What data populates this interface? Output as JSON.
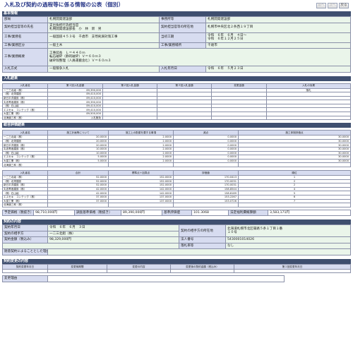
{
  "page": {
    "title": "入札及び契約の過程等に係る情報の公表（個別）"
  },
  "nav": {
    "prev": "前へ",
    "next": "次へ",
    "back": "戻る"
  },
  "basic": {
    "heading": "基本情報",
    "dept_label": "部局",
    "dept": "札幌開発建設部",
    "office_label": "事務所等",
    "office": "札幌開発建設部",
    "contractor_label": "契約担当官等の氏名",
    "contractor_1": "支出負担行為担当官",
    "contractor_2": "札幌開発建設部長　小　林　新　男",
    "contractor_addr_label": "契約担当官等の所在地",
    "contractor_addr": "札幌市中央区北２条西１９丁目",
    "work_name_label": "工事/業務名",
    "work_name": "一般国道４５３号　千歳市　支笏剣淵対策工事",
    "period_label": "当初工期",
    "period_1": "令和　６年　６月　４日～",
    "period_2": "令和　６年１２月２５日",
    "category_label": "工事/業務区分",
    "category": "一般土木",
    "place_label": "工事/業務場所",
    "place": "千歳市",
    "summary_label": "工事/業務概要",
    "summary_1": "工事延長　Ｌ＝４４０ｍ",
    "summary_2": "転石破砕（静的破砕）Ｖ＝６０ｍ３",
    "summary_3": "破砕殻整理（人員運搬含む）Ｖ＝６０ｍ３",
    "method_label": "入札方式",
    "method": "一般競争入札",
    "bid_date_label": "入札年月日",
    "bid_date": "令和　６年　５月２３日"
  },
  "results": {
    "heading": "入札結果",
    "headers": [
      "入札者名",
      "第１回入札金額",
      "第２回入札金額",
      "第３回入札金額",
      "変更金額",
      "入札の効果"
    ],
    "rows": [
      {
        "name": "一二三北組（株）",
        "v1": "89,390,000",
        "v2": "",
        "v3": "",
        "v4": "",
        "v5": "落札"
      },
      {
        "name": "（株）北栄建設",
        "v1": "89,410,000",
        "v2": "",
        "v3": "",
        "v4": "",
        "v5": ""
      },
      {
        "name": "新日平洋建設（株）",
        "v1": "89,410,000",
        "v2": "",
        "v3": "",
        "v4": "",
        "v5": ""
      },
      {
        "name": "丸忠青函建設（株）",
        "v1": "89,390,000",
        "v2": "",
        "v3": "",
        "v4": "",
        "v5": ""
      },
      {
        "name": "（株）石山組",
        "v1": "89,410,000",
        "v2": "",
        "v3": "",
        "v4": "",
        "v5": ""
      },
      {
        "name": "エスセキ　コンテック（株）",
        "v1": "89,410,000",
        "v2": "",
        "v3": "",
        "v4": "",
        "v5": ""
      },
      {
        "name": "大富工業（株）",
        "v1": "89,500,000",
        "v2": "",
        "v3": "",
        "v4": "",
        "v5": ""
      },
      {
        "name": "北海道三和（株）",
        "v1": "入札無効",
        "v2": "",
        "v3": "",
        "v4": "",
        "v5": ""
      }
    ]
  },
  "evaluation": {
    "heading": "総合評価結果",
    "headers_a": [
      "入札者名",
      "施工計画等について",
      "施工上の配慮を要する事項",
      "減点",
      "施工体制評価点"
    ],
    "rows_a": [
      {
        "name": "一二三北組（株）",
        "c1": "20.0000",
        "c2": "2.0000",
        "c3": "0.0000",
        "c4": "30.0000"
      },
      {
        "name": "（株）北栄建設",
        "c1": "20.0000",
        "c2": "2.0000",
        "c3": "0.0000",
        "c4": "30.0000"
      },
      {
        "name": "新日平洋建設（株）",
        "c1": "20.0000",
        "c2": "2.0000",
        "c3": "0.0000",
        "c4": "30.0000"
      },
      {
        "name": "丸忠青函建設（株）",
        "c1": "10.0000",
        "c2": "2.0000",
        "c3": "0.0000",
        "c4": "30.0000"
      },
      {
        "name": "（株）石山組",
        "c1": "10.0000",
        "c2": "2.0000",
        "c3": "0.0000",
        "c4": "30.0000"
      },
      {
        "name": "エスセキ　コンテック（株）",
        "c1": "5.0000",
        "c2": "2.0000",
        "c3": "0.0000",
        "c4": "30.0000"
      },
      {
        "name": "大富工業（株）",
        "c1": "5.0000",
        "c2": "2.0000",
        "c3": "0.0000",
        "c4": "30.0000"
      },
      {
        "name": "北海道三和（株）",
        "c1": "",
        "c2": "",
        "c3": "",
        "c4": ""
      }
    ],
    "headers_b": [
      "入札者名",
      "合計",
      "標準点＋加算点",
      "評価値",
      "順位"
    ],
    "rows_b": [
      {
        "name": "一二三北組（株）",
        "c1": "52.0000",
        "c2": "152.0000",
        "c3": "170.0413",
        "c4": "1"
      },
      {
        "name": "（株）北栄建設",
        "c1": "52.0000",
        "c2": "152.0000",
        "c3": "170.0031",
        "c4": "2"
      },
      {
        "name": "新日平洋建設（株）",
        "c1": "52.0000",
        "c2": "152.0000",
        "c3": "170.0031",
        "c4": "2"
      },
      {
        "name": "丸忠青函建設（株）",
        "c1": "42.0000",
        "c2": "142.0000",
        "c3": "158.8544",
        "c4": "4"
      },
      {
        "name": "（株）石山組",
        "c1": "42.0000",
        "c2": "142.0000",
        "c3": "158.8189",
        "c4": "5"
      },
      {
        "name": "エスセキ　コンテック（株）",
        "c1": "37.0000",
        "c2": "137.0000",
        "c3": "153.2267",
        "c4": "6"
      },
      {
        "name": "大富工業（株）",
        "c1": "37.0000",
        "c2": "137.0000",
        "c3": "153.0726",
        "c4": "7"
      },
      {
        "name": "北海道三和（株）",
        "c1": "",
        "c2": "",
        "c3": "",
        "c4": ""
      }
    ],
    "summary": {
      "l1": "予定価格（税抜き）",
      "v1": "98,710,000円",
      "l2": "調査基準価格（税抜き）",
      "v2": "89,390,000円",
      "l3": "基準評価値",
      "v3": "101.3068",
      "l4": "法定福利費概算額",
      "v4": "3,583,171円"
    }
  },
  "contract": {
    "heading": "契約の内容",
    "date_label": "契約年月日",
    "date": "令和　６年　６月　３日",
    "partner_addr_label": "契約の相手方の所在地",
    "partner_addr_1": "北海道札幌市北区篠路５条１丁目１番",
    "partner_addr_2": "１０号",
    "partner_label": "契約の相手方",
    "partner": "一二三北組（株）",
    "corp_no_label": "法人番号",
    "corp_no": "5430001014026",
    "amount_label": "契約金額（税込み）",
    "amount": "98,329,000円",
    "donation_label": "落札率等",
    "donation": "なし",
    "reason_label": "随意契約によることとした理由",
    "reason": ""
  },
  "change": {
    "heading": "契約変更の内容",
    "headers": [
      "契約変更年月日",
      "変更後期間",
      "変更の内容",
      "変更後の契約金額（税込み）",
      "第１回変更年月日"
    ],
    "reason_label": "変更理由"
  }
}
